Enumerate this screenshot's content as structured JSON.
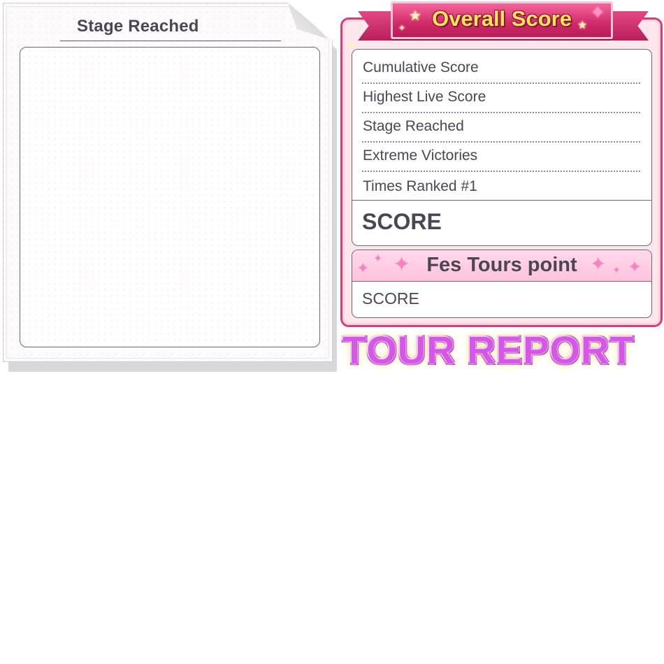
{
  "left_panel": {
    "title": "Stage Reached"
  },
  "overall_score": {
    "banner_title": "Overall Score",
    "rows": [
      "Cumulative Score",
      "Highest Live Score",
      "Stage Reached",
      "Extreme Victories",
      "Times Ranked #1"
    ],
    "total_label": "SCORE"
  },
  "fes_tours": {
    "title": "Fes Tours point",
    "score_label": "SCORE"
  },
  "footer_title": "TOUR REPORT",
  "colors": {
    "accent_pink": "#d53f77",
    "banner_text": "#ffe45c",
    "report_purple": "#d657e6",
    "text_dark": "#4b4654"
  }
}
